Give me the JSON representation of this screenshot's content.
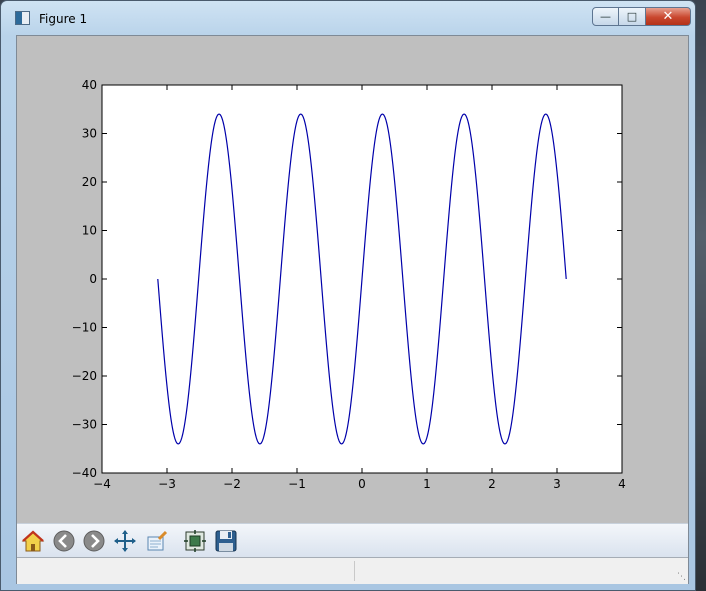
{
  "window": {
    "title": "Figure 1",
    "buttons": {
      "minimize": "minimize",
      "maximize": "maximize",
      "close": "close"
    }
  },
  "toolbar": {
    "items": [
      {
        "name": "home-icon",
        "label": "Home"
      },
      {
        "name": "back-icon",
        "label": "Back"
      },
      {
        "name": "forward-icon",
        "label": "Forward"
      },
      {
        "name": "pan-icon",
        "label": "Pan"
      },
      {
        "name": "zoom-icon",
        "label": "Zoom"
      },
      {
        "name": "subplots-icon",
        "label": "Configure subplots"
      },
      {
        "name": "save-icon",
        "label": "Save"
      }
    ]
  },
  "colors": {
    "line": "#0000aa",
    "figure_bg": "#bfbfbf",
    "axes_bg": "#ffffff"
  },
  "chart_data": {
    "type": "line",
    "title": "",
    "xlabel": "",
    "ylabel": "",
    "xlim": [
      -4,
      4
    ],
    "ylim": [
      -40,
      40
    ],
    "xticks": [
      "−4",
      "−3",
      "−2",
      "−1",
      "0",
      "1",
      "2",
      "3",
      "4"
    ],
    "yticks": [
      "40",
      "30",
      "20",
      "10",
      "0",
      "−10",
      "−20",
      "−30",
      "−40"
    ],
    "grid": false,
    "legend": "none",
    "series": [
      {
        "function": "34*sin(5x)",
        "x_range": [
          -3.14159,
          3.14159
        ],
        "amplitude": 34,
        "frequency": 5
      }
    ]
  }
}
